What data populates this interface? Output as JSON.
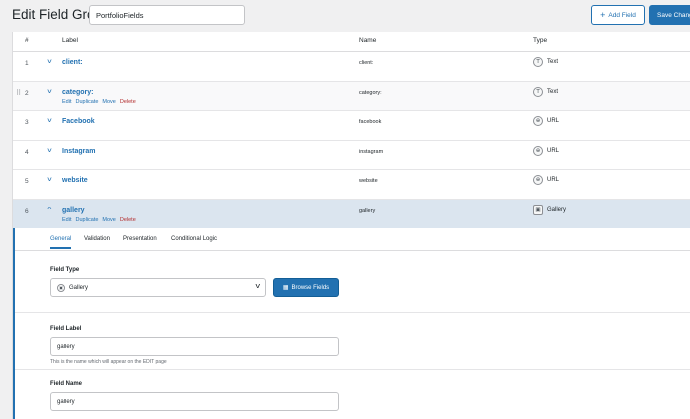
{
  "header": {
    "title": "Edit Field Group",
    "group_title": "PortfolioFields",
    "add_field_label": "Add Field",
    "save_label": "Save Changes"
  },
  "table": {
    "headers": {
      "num": "#",
      "label": "Label",
      "name": "Name",
      "type": "Type"
    },
    "rows": [
      {
        "num": "1",
        "label": "client:",
        "name": "client:",
        "type": "Text",
        "icon": "T"
      },
      {
        "num": "2",
        "label": "category:",
        "name": "category:",
        "type": "Text",
        "icon": "T",
        "actions": [
          "Edit",
          "Duplicate",
          "Move",
          "Delete"
        ]
      },
      {
        "num": "3",
        "label": "Facebook",
        "name": "facebook",
        "type": "URL",
        "icon": "⊕"
      },
      {
        "num": "4",
        "label": "Instagram",
        "name": "instagram",
        "type": "URL",
        "icon": "⊕"
      },
      {
        "num": "5",
        "label": "website",
        "name": "website",
        "type": "URL",
        "icon": "⊕"
      },
      {
        "num": "6",
        "label": "gallery",
        "name": "gallery",
        "type": "Gallery",
        "icon": "▣",
        "actions": [
          "Edit",
          "Duplicate",
          "Move",
          "Delete"
        ]
      }
    ]
  },
  "settings": {
    "tabs": [
      "General",
      "Validation",
      "Presentation",
      "Conditional Logic"
    ],
    "active_tab": "General",
    "field_type_label": "Field Type",
    "field_type_value": "Gallery",
    "browse_label": "Browse Fields",
    "field_label_label": "Field Label",
    "field_label_value": "gallery",
    "field_label_help": "This is the name which will appear on the EDIT page",
    "field_name_label": "Field Name",
    "field_name_value": "gallery"
  },
  "colors": {
    "accent": "#2271b1",
    "delete": "#b32d2e",
    "active_row": "#dbe5ef"
  }
}
